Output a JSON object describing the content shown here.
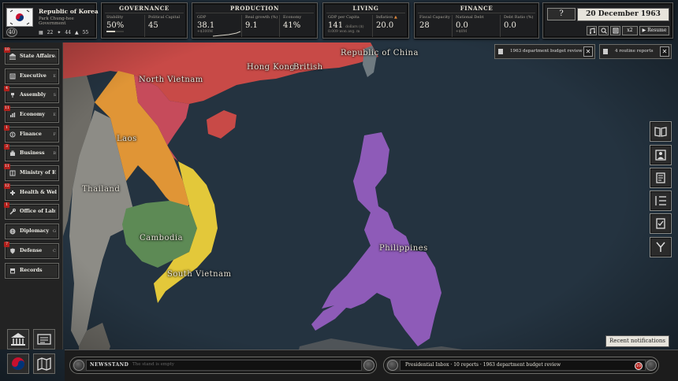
{
  "map": {
    "labels": {
      "republic_of_china": "Republic of China",
      "hong_kong": "Hong Kong",
      "british": "British",
      "north_vietnam": "North Vietnam",
      "laos": "Laos",
      "thailand": "Thailand",
      "cambodia": "Cambodia",
      "south_vietnam": "South Vietnam",
      "philippines": "Philippines"
    },
    "colors": {
      "sea": "#243340",
      "china": "#c84a47",
      "north_vietnam": "#c64b5b",
      "laos": "#e09536",
      "thailand": "#8d8c86",
      "cambodia": "#5d8a55",
      "south_vietnam": "#e3c83a",
      "philippines": "#8e5bb8"
    }
  },
  "country": {
    "name": "Republic of Korea",
    "leader": "Park Chung-hee",
    "government": "Government",
    "level": "40",
    "stats": [
      "22",
      "44",
      "55"
    ]
  },
  "governance": {
    "title": "GOVERNANCE",
    "stability_label": "Stability",
    "stability_value": "50%",
    "stability_fraction": 0.5,
    "capital_label": "Political Capital",
    "capital_value": "45"
  },
  "production": {
    "title": "PRODUCTION",
    "gdp_label": "GDP",
    "gdp_value": "38.1",
    "gdp_sub": "+$300M",
    "growth_label": "Real growth (%)",
    "growth_value": "9.1",
    "economy_label": "Economy",
    "economy_value": "41%"
  },
  "living": {
    "title": "LIVING",
    "gdp_capita_label": "GDP per Capita",
    "gdp_capita_value": "141",
    "gdp_capita_unit": "dollars ($)",
    "gdp_capita_sub": "0.009 won avg. m",
    "inflation_label": "Inflation",
    "inflation_value": "20.0"
  },
  "finance": {
    "title": "FINANCE",
    "fiscal_label": "Fiscal Capacity",
    "fiscal_value": "28",
    "debt_label": "National Debt",
    "debt_value": "0.0",
    "debt_sub": "+$0M",
    "ratio_label": "Debt Ratio (%)",
    "ratio_value": "0.0"
  },
  "controls": {
    "help": "?",
    "date": "20 December 1963",
    "speed": "x2",
    "resume": "Resume"
  },
  "sidebar": {
    "items": [
      {
        "label": "State Affairs",
        "badge": "10",
        "count": "A"
      },
      {
        "label": "Executive",
        "badge": "",
        "count": "E"
      },
      {
        "label": "Assembly",
        "badge": "4",
        "count": "S"
      },
      {
        "label": "Economy",
        "badge": "11",
        "count": "E"
      },
      {
        "label": "Finance",
        "badge": "1",
        "count": "F"
      },
      {
        "label": "Business",
        "badge": "3",
        "count": "B"
      },
      {
        "label": "Ministry of E",
        "badge": "11",
        "count": "E"
      },
      {
        "label": "Health & Wel",
        "badge": "12",
        "count": "H"
      },
      {
        "label": "Office of Lab",
        "badge": "1",
        "count": "Z"
      },
      {
        "label": "Diplomacy",
        "badge": "",
        "count": "G"
      },
      {
        "label": "Defense",
        "badge": "7",
        "count": "C"
      },
      {
        "label": "Records",
        "badge": "",
        "count": ""
      }
    ]
  },
  "notifications": {
    "budget_review": "1963 department budget review",
    "routine_reports": "4 routine reports",
    "recent": "Recent notifications"
  },
  "bottom": {
    "newsstand": "NEWSSTAND",
    "newsstand_empty": "The stand is empty",
    "inbox": "Presidential Inbox · 10 reports · 1963 department budget review",
    "inbox_count": "10"
  }
}
